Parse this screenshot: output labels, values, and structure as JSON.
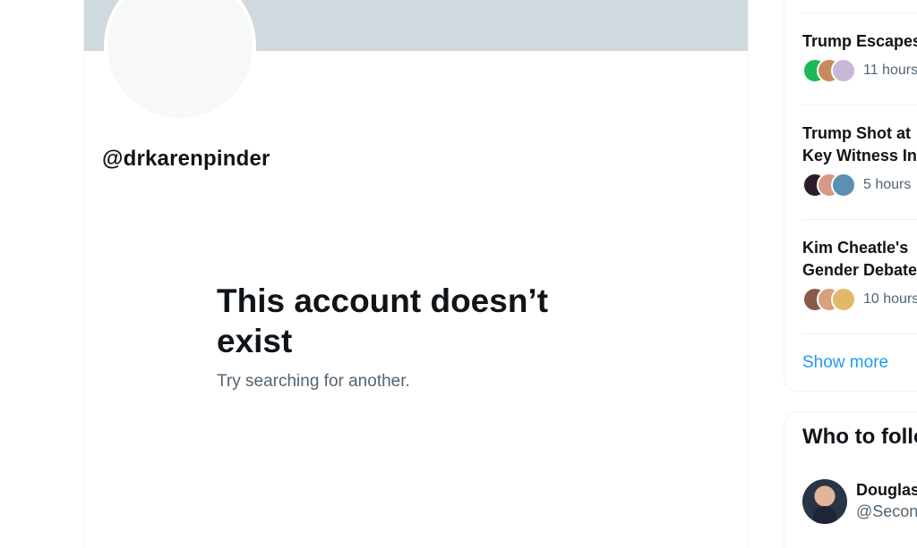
{
  "profile": {
    "handle": "@drkarenpinder"
  },
  "empty_state": {
    "title": "This account doesn’t exist",
    "subtitle": "Try searching for another."
  },
  "trends": {
    "items": [
      {
        "title": "Trump Escapes",
        "time": "11 hours",
        "avatar_colors": [
          "#1db954",
          "#c98a5a",
          "#c5b8d8"
        ]
      },
      {
        "title": "Trump Shot at",
        "title2": "Key Witness In",
        "time": "5 hours",
        "avatar_colors": [
          "#2b1e2a",
          "#d49a84",
          "#5c8fb0"
        ]
      },
      {
        "title": "Kim Cheatle's",
        "title2": "Gender Debate",
        "time": "10 hours",
        "avatar_colors": [
          "#8a5a4a",
          "#d9a07e",
          "#e2b96a"
        ]
      }
    ],
    "show_more": "Show more"
  },
  "who_to_follow": {
    "title": "Who to follow",
    "user": {
      "name": "Douglas",
      "handle": "@Secon"
    }
  },
  "colors": {
    "banner": "#cfd9de",
    "link": "#1d9bf0",
    "secondary_text": "#536471"
  }
}
